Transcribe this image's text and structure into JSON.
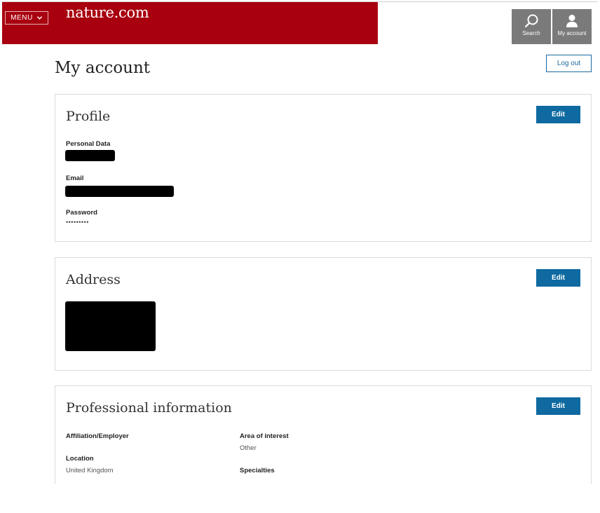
{
  "header": {
    "menu_label": "MENU",
    "logo_text": "nature.com",
    "search_label": "Search",
    "account_label": "My account",
    "brand_color": "#a8000f"
  },
  "page": {
    "title": "My account",
    "logout_label": "Log out"
  },
  "profile": {
    "title": "Profile",
    "edit_label": "Edit",
    "personal_data_label": "Personal Data",
    "email_label": "Email",
    "password_label": "Password",
    "password_value": "•••••••••"
  },
  "address": {
    "title": "Address",
    "edit_label": "Edit"
  },
  "professional": {
    "title": "Professional information",
    "edit_label": "Edit",
    "affiliation_label": "Affiliation/Employer",
    "location_label": "Location",
    "location_value": "United Kingdom",
    "interest_label": "Area of interest",
    "interest_value": "Other",
    "specialties_label": "Specialties"
  }
}
